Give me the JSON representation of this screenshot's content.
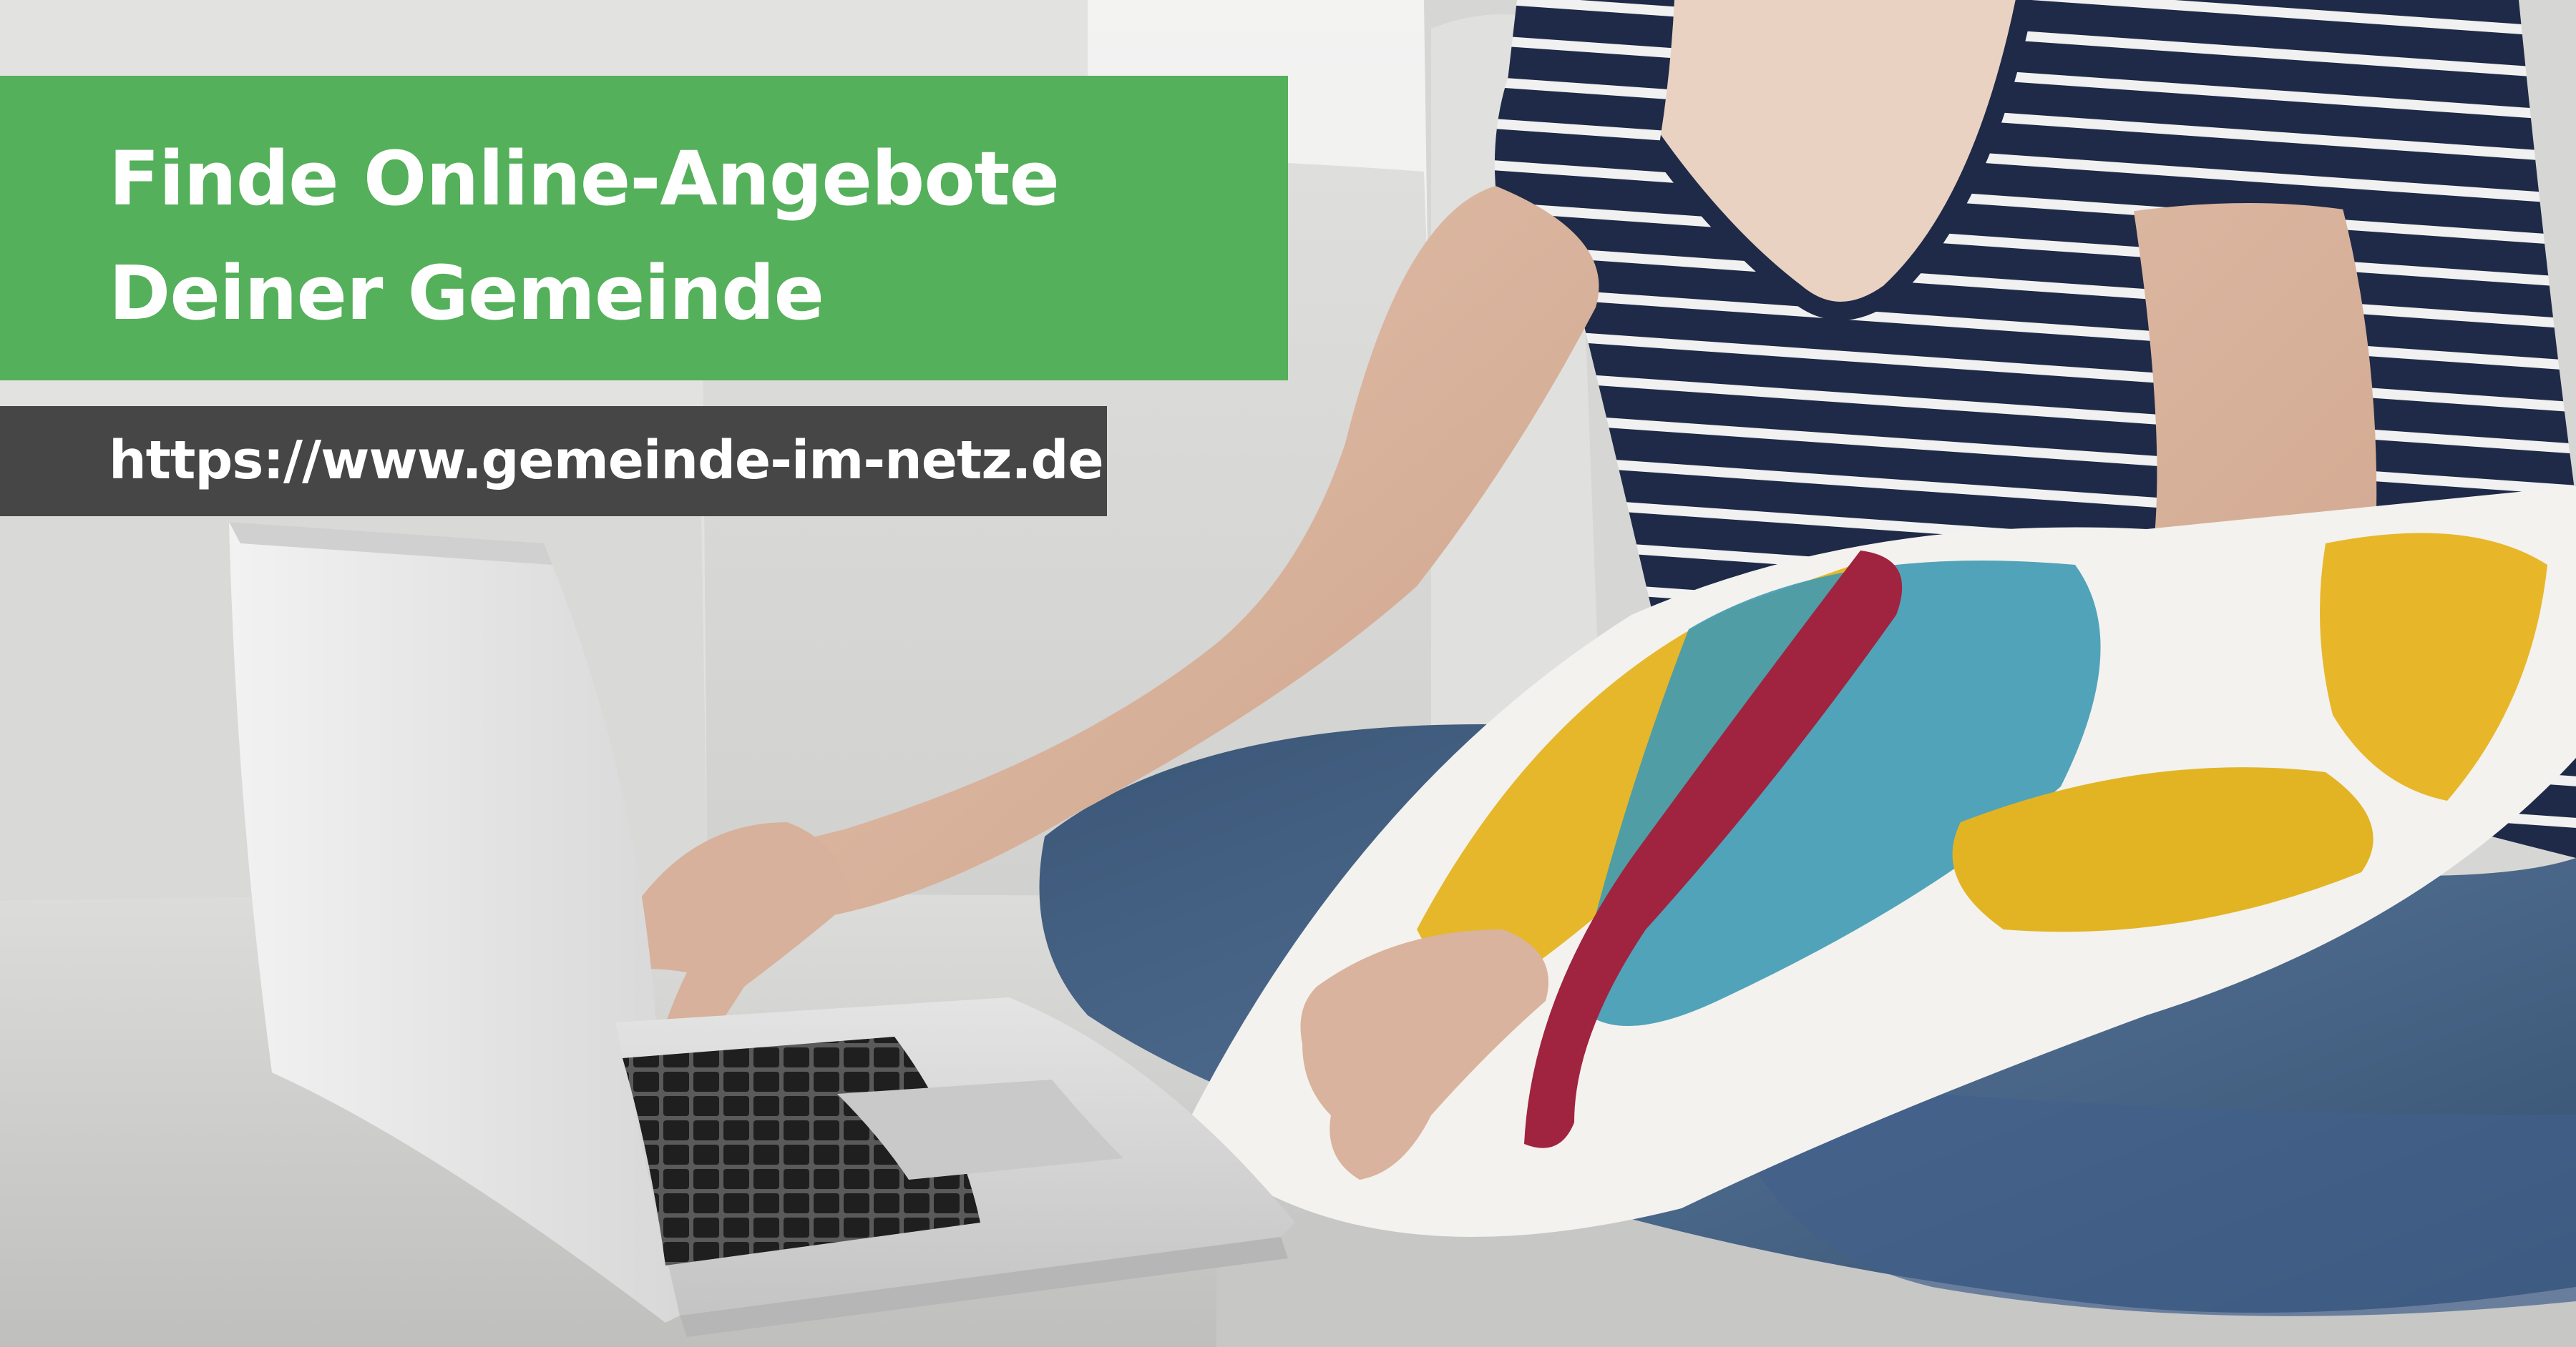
{
  "banner": {
    "headline_line1": "Finde Online-Angebote",
    "headline_line2": "Deiner Gemeinde",
    "url": "https://www.gemeinde-im-netz.de"
  },
  "colors": {
    "headline_background": "#54b05a",
    "url_background": "#464646",
    "text": "#ffffff"
  },
  "photo": {
    "subject": "person sitting on a light grey sofa typing on a silver laptop, holding a colorful pillow"
  }
}
